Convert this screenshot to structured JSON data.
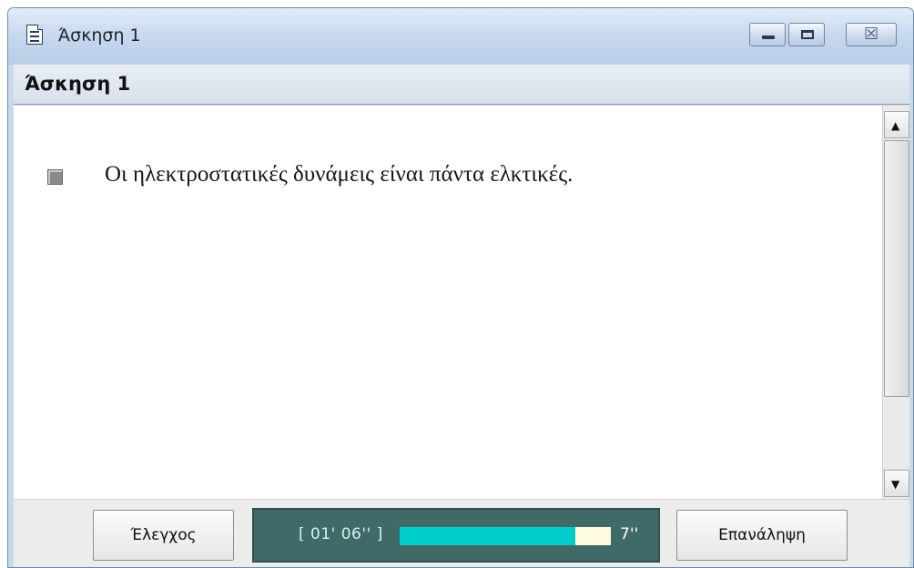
{
  "window": {
    "title": "Άσκηση 1",
    "icon": "document-icon",
    "controls": [
      "minimize-icon",
      "maximize-icon",
      "close-icon"
    ],
    "close_glyph": "☒"
  },
  "header": {
    "title": "Άσκηση 1"
  },
  "exercise": {
    "checkbox_checked": false,
    "statement": "Οι ηλεκτροστατικές δυνάμεις είναι πάντα ελκτικές."
  },
  "scrollbar": {
    "up_glyph": "▲",
    "down_glyph": "▼"
  },
  "footer": {
    "check_label": "Έλεγχος",
    "repeat_label": "Επανάληψη",
    "timer": {
      "elapsed": "[ 01' 06'' ]",
      "remaining": "7''",
      "progress_fraction": 0.83,
      "fill_color": "#00cccc",
      "track_color": "#fffbe0",
      "panel_color": "#3f6a68"
    }
  }
}
